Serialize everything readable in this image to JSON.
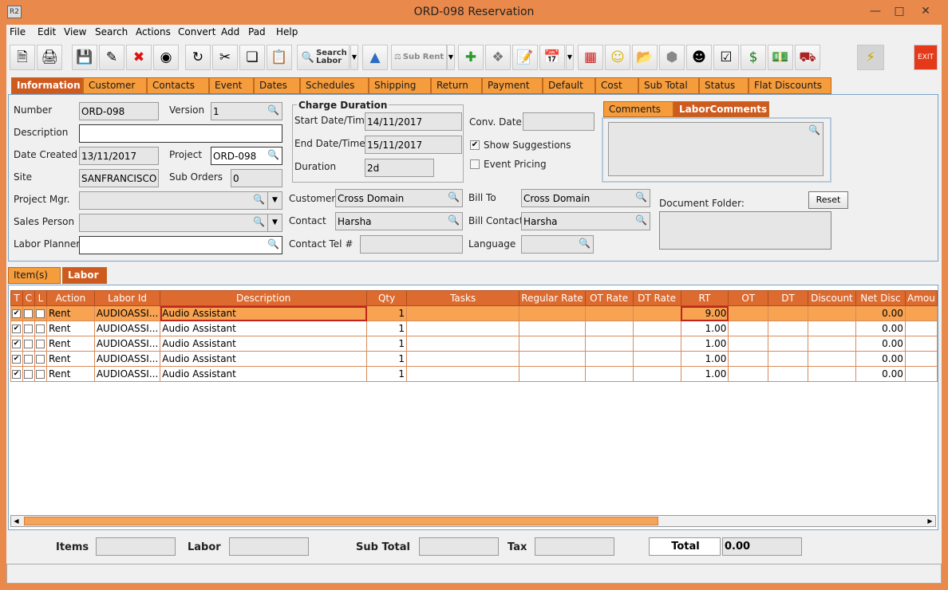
{
  "window": {
    "title": "ORD-098 Reservation",
    "app_icon": "R2"
  },
  "menu": [
    "File",
    "Edit",
    "View",
    "Search",
    "Actions",
    "Convert",
    "Add",
    "Pad",
    "Help"
  ],
  "toolbar": {
    "search_labor": "Search Labor",
    "sub_rent": "Sub Rent",
    "exit": "EXIT"
  },
  "tabs": [
    "Information",
    "Customer",
    "Contacts",
    "Event",
    "Dates",
    "Schedules",
    "Shipping",
    "Return",
    "Payment",
    "Default",
    "Cost",
    "Sub Total",
    "Status",
    "Flat Discounts"
  ],
  "form": {
    "number_label": "Number",
    "number": "ORD-098",
    "version_label": "Version",
    "version": "1",
    "description_label": "Description",
    "description": "",
    "date_created_label": "Date Created",
    "date_created": "13/11/2017",
    "project_label": "Project",
    "project": "ORD-098",
    "site_label": "Site",
    "site": "SANFRANCISCO",
    "sub_orders_label": "Sub Orders",
    "sub_orders": "0",
    "project_mgr_label": "Project Mgr.",
    "project_mgr": "",
    "sales_person_label": "Sales Person",
    "sales_person": "",
    "labor_planner_label": "Labor Planner",
    "labor_planner": "",
    "charge_duration_label": "Charge Duration",
    "start_label": "Start Date/Time",
    "start": "14/11/2017",
    "end_label": "End Date/Time",
    "end": "15/11/2017",
    "duration_label": "Duration",
    "duration": "2d",
    "conv_date_label": "Conv. Date",
    "conv_date": "",
    "show_suggestions_label": "Show Suggestions",
    "show_suggestions": true,
    "event_pricing_label": "Event Pricing",
    "event_pricing": false,
    "customer_label": "Customer",
    "customer": "Cross Domain",
    "bill_to_label": "Bill To",
    "bill_to": "Cross Domain",
    "contact_label": "Contact",
    "contact": "Harsha",
    "bill_contact_label": "Bill Contact",
    "bill_contact": "Harsha",
    "contact_tel_label": "Contact Tel #",
    "contact_tel": "",
    "language_label": "Language",
    "language": "",
    "comment_tabs": [
      "Comments",
      "LaborComments"
    ],
    "document_folder_label": "Document Folder:",
    "reset_label": "Reset"
  },
  "subtabs": [
    "Item(s)",
    "Labor"
  ],
  "grid": {
    "columns": [
      "T",
      "C",
      "L",
      "Action",
      "Labor Id",
      "Description",
      "Qty",
      "Tasks",
      "Regular Rate",
      "OT Rate",
      "DT Rate",
      "RT",
      "OT",
      "DT",
      "Discount",
      "Net Disc",
      "Amou"
    ],
    "rows": [
      {
        "t": true,
        "action": "Rent",
        "labor_id": "AUDIOASSI...",
        "description": "Audio Assistant",
        "qty": "1",
        "rt": "9.00",
        "net_disc": "0.00"
      },
      {
        "t": true,
        "action": "Rent",
        "labor_id": "AUDIOASSI...",
        "description": "Audio Assistant",
        "qty": "1",
        "rt": "1.00",
        "net_disc": "0.00"
      },
      {
        "t": true,
        "action": "Rent",
        "labor_id": "AUDIOASSI...",
        "description": "Audio Assistant",
        "qty": "1",
        "rt": "1.00",
        "net_disc": "0.00"
      },
      {
        "t": true,
        "action": "Rent",
        "labor_id": "AUDIOASSI...",
        "description": "Audio Assistant",
        "qty": "1",
        "rt": "1.00",
        "net_disc": "0.00"
      },
      {
        "t": true,
        "action": "Rent",
        "labor_id": "AUDIOASSI...",
        "description": "Audio Assistant",
        "qty": "1",
        "rt": "1.00",
        "net_disc": "0.00"
      }
    ]
  },
  "footer": {
    "items_label": "Items",
    "items": "",
    "labor_label": "Labor",
    "labor": "",
    "sub_total_label": "Sub Total",
    "sub_total": "",
    "tax_label": "Tax",
    "tax": "",
    "total_label": "Total",
    "total": "0.00"
  },
  "colors": {
    "accent": "#e9894b",
    "tab": "#f59c3c",
    "tab_active": "#cf5a1e",
    "selected_row": "#f7a352"
  }
}
